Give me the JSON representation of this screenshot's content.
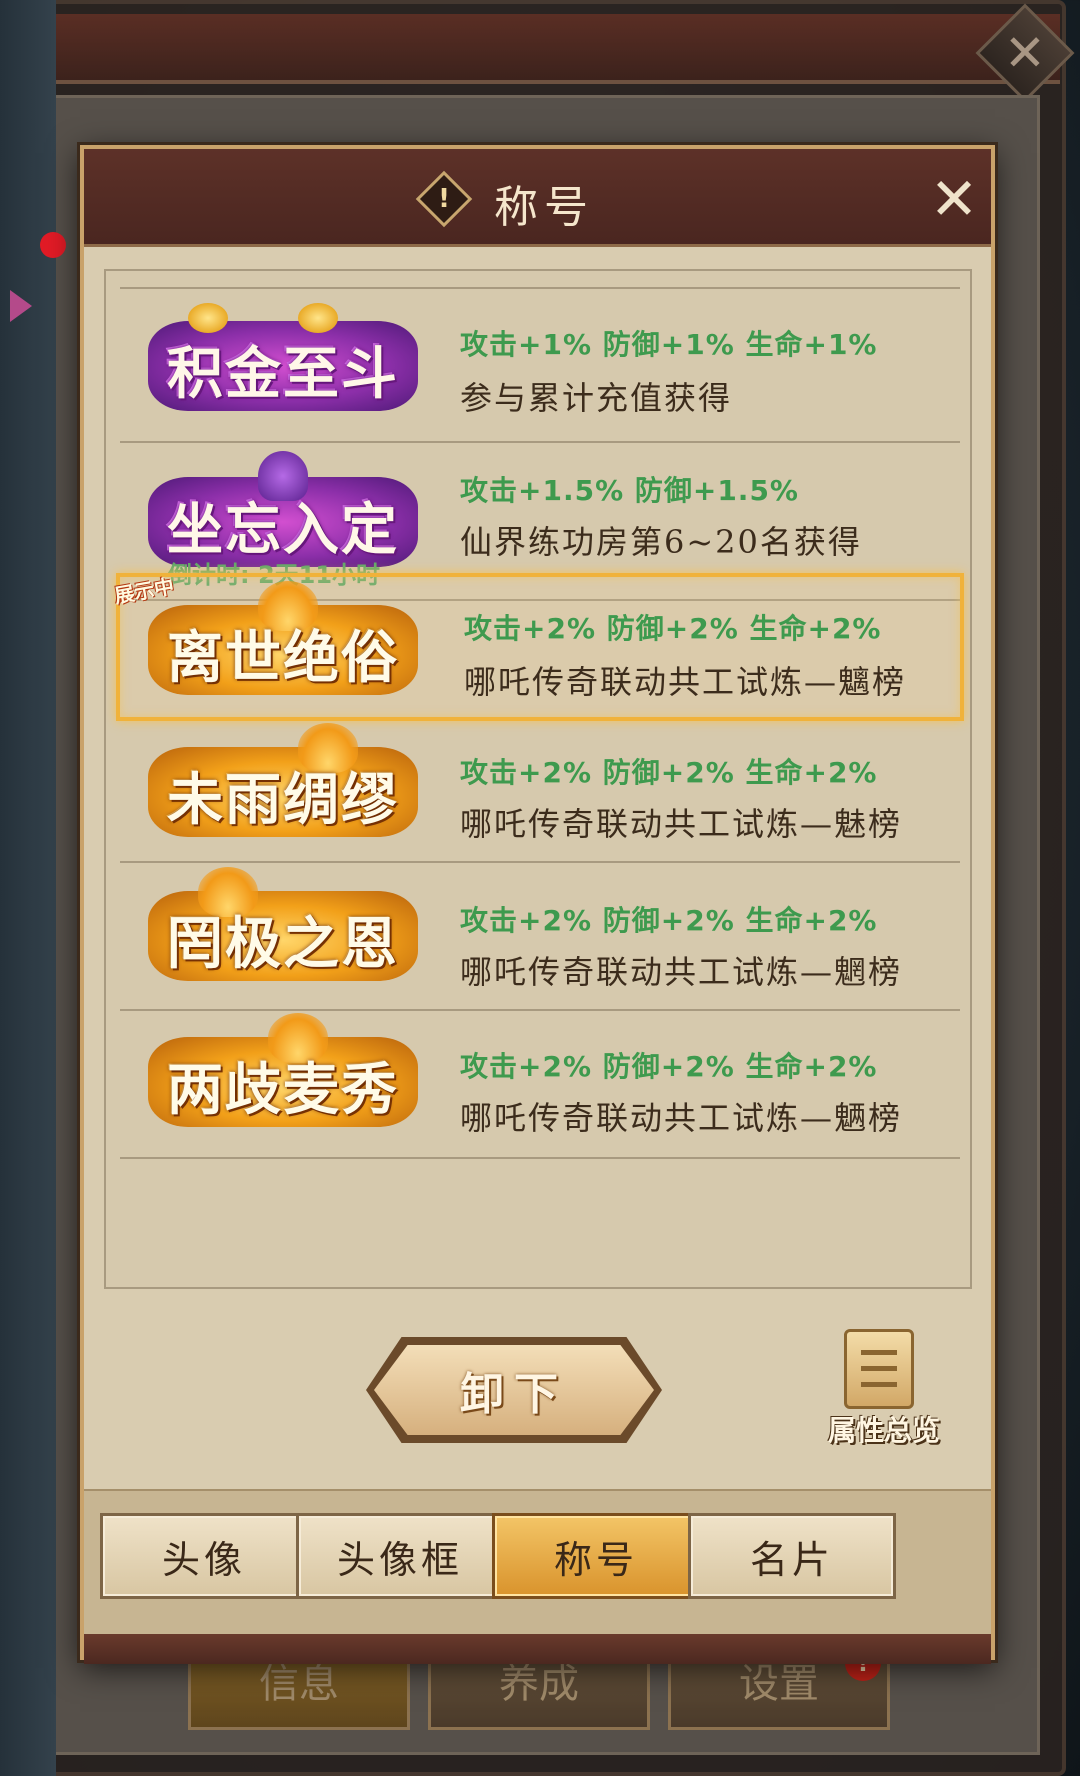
{
  "background": {
    "tabs": [
      "信息",
      "养成",
      "设置"
    ],
    "badge": "!"
  },
  "dialog": {
    "title": "称号",
    "close_icon": "✕",
    "info_icon": "!",
    "titles": [
      {
        "name": "积金至斗",
        "style": "purple",
        "stats": "攻击+1% 防御+1% 生命+1%",
        "desc": "参与累计充值获得"
      },
      {
        "name": "坐忘入定",
        "style": "purple",
        "stats": "攻击+1.5% 防御+1.5%",
        "desc": "仙界练功房第6~20名获得",
        "countdown": "倒计时: 2天11小时"
      },
      {
        "name": "离世绝俗",
        "style": "gold",
        "stats": "攻击+2% 防御+2% 生命+2%",
        "desc": "哪吒传奇联动共工试炼—魑榜",
        "tag": "展示中",
        "selected": true
      },
      {
        "name": "未雨绸缪",
        "style": "gold",
        "stats": "攻击+2% 防御+2% 生命+2%",
        "desc": "哪吒传奇联动共工试炼—魅榜"
      },
      {
        "name": "罔极之恩",
        "style": "gold",
        "stats": "攻击+2% 防御+2% 生命+2%",
        "desc": "哪吒传奇联动共工试炼—魍榜"
      },
      {
        "name": "两歧麦秀",
        "style": "gold",
        "stats": "攻击+2% 防御+2% 生命+2%",
        "desc": "哪吒传奇联动共工试炼—魉榜"
      }
    ],
    "unequip_label": "卸下",
    "overview_label": "属性总览",
    "tabs": [
      {
        "label": "头像",
        "active": false
      },
      {
        "label": "头像框",
        "active": false
      },
      {
        "label": "称号",
        "active": true
      },
      {
        "label": "名片",
        "active": false
      }
    ]
  },
  "colors": {
    "stat_green": "#3e9a4e",
    "selected_border": "#f0b23a",
    "active_tab": "#e9ac48"
  }
}
